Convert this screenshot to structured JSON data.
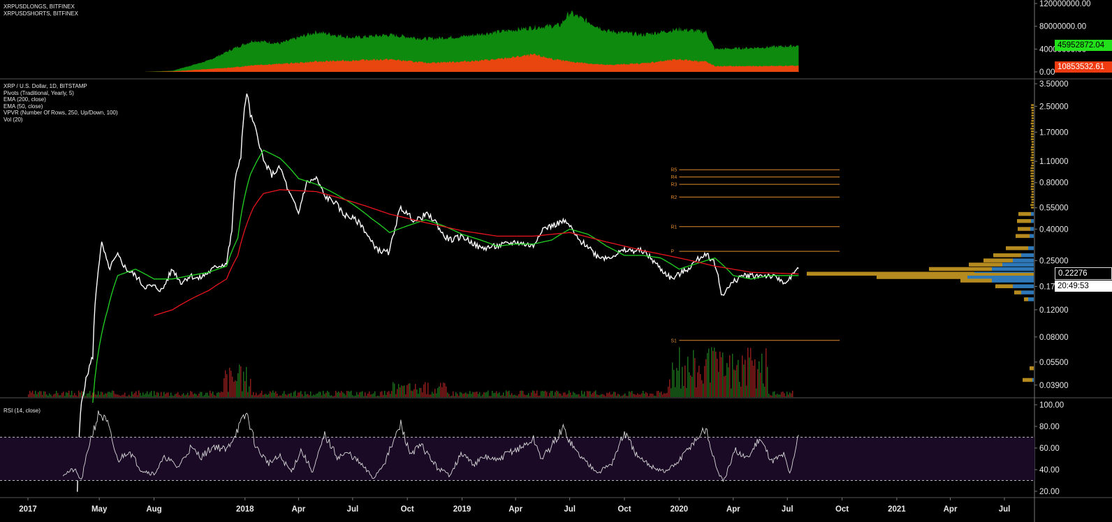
{
  "legends": {
    "top": [
      "XRPUSDLONGS, BITFINEX",
      "XRPUSDSHORTS, BITFINEX"
    ],
    "main": [
      "XRP / U.S. Dollar, 1D, BITSTAMP",
      "Pivots (Traditional, Yearly, 5)",
      "EMA (200, close)",
      "EMA (50, close)",
      "VPVR (Number Of Rows, 250, Up/Down, 100)",
      "Vol (20)"
    ],
    "rsi": [
      "RSI (14, close)"
    ]
  },
  "badges": {
    "longs": "45952872.04",
    "shorts": "10853532.61",
    "price": "0.22276",
    "countdown": "20:49:53"
  },
  "colors": {
    "longs": "#0e8a0e",
    "shorts": "#e8460e",
    "price": "#ffffff",
    "ema200": "#e8141e",
    "ema50": "#22d322",
    "pivot": "#e08a2e",
    "vol_up": "#1f7a1f",
    "vol_down": "#a02020",
    "vpvr_up": "#2f78b8",
    "vpvr_down": "#b58a1e",
    "rsi_line": "#d8d8d8",
    "rsi_band": "#1a0a26",
    "longs_badge": "#22e01a",
    "shorts_badge": "#f03a10"
  },
  "chart_data": [
    {
      "type": "area",
      "pane": "longs-shorts",
      "yticks": [
        "120000000.00",
        "80000000.00",
        "40000000.00",
        "0.00"
      ],
      "ylim": [
        0,
        120000000
      ],
      "series": [
        {
          "name": "XRPUSDLONGS, BITFINEX",
          "x": [
            "2017-07-15",
            "2017-09-01",
            "2017-11-01",
            "2017-12-15",
            "2018-01-15",
            "2018-03-01",
            "2018-05-01",
            "2018-07-01",
            "2018-09-01",
            "2018-11-01",
            "2019-01-01",
            "2019-03-01",
            "2019-05-01",
            "2019-06-15",
            "2019-07-01",
            "2019-09-01",
            "2019-11-01",
            "2020-01-01",
            "2020-02-15",
            "2020-03-01",
            "2020-05-01",
            "2020-07-20"
          ],
          "values": [
            0,
            2000000,
            20000000,
            42000000,
            55000000,
            50000000,
            70000000,
            60000000,
            65000000,
            58000000,
            62000000,
            70000000,
            78000000,
            82000000,
            104000000,
            72000000,
            65000000,
            75000000,
            70000000,
            40000000,
            42000000,
            46000000
          ]
        },
        {
          "name": "XRPUSDSHORTS, BITFINEX",
          "x": [
            "2017-07-15",
            "2017-09-01",
            "2017-11-01",
            "2017-12-15",
            "2018-01-15",
            "2018-03-01",
            "2018-05-01",
            "2018-07-01",
            "2018-09-01",
            "2018-11-01",
            "2019-01-01",
            "2019-03-01",
            "2019-05-01",
            "2019-06-15",
            "2019-07-01",
            "2019-09-01",
            "2019-11-01",
            "2020-01-01",
            "2020-02-15",
            "2020-03-01",
            "2020-05-01",
            "2020-07-20"
          ],
          "values": [
            0,
            1000000,
            5000000,
            8000000,
            12000000,
            14000000,
            18000000,
            20000000,
            22000000,
            16000000,
            18000000,
            22000000,
            30000000,
            20000000,
            18000000,
            12000000,
            15000000,
            22000000,
            18000000,
            10000000,
            10000000,
            10853532
          ]
        }
      ]
    },
    {
      "type": "line",
      "pane": "price",
      "scale": "log",
      "yticks": [
        "3.50000",
        "2.50000",
        "1.70000",
        "1.10000",
        "0.80000",
        "0.55000",
        "0.40000",
        "0.25000",
        "0.17000",
        "0.12000",
        "0.08000",
        "0.05500",
        "0.03900"
      ],
      "ylim": [
        0.034,
        3.5
      ],
      "xticks": [
        "2017",
        "May",
        "Aug",
        "2018",
        "Apr",
        "Jul",
        "Oct",
        "2019",
        "Apr",
        "Jul",
        "Oct",
        "2020",
        "Apr",
        "Jul",
        "Oct",
        "2021",
        "Apr",
        "Jul"
      ],
      "series": [
        {
          "name": "XRP / U.S. Dollar",
          "x": [
            "2017-03-25",
            "2017-04-01",
            "2017-04-20",
            "2017-05-05",
            "2017-05-17",
            "2017-06-01",
            "2017-06-15",
            "2017-07-01",
            "2017-07-15",
            "2017-08-01",
            "2017-08-15",
            "2017-09-01",
            "2017-09-15",
            "2017-10-01",
            "2017-10-15",
            "2017-11-01",
            "2017-11-15",
            "2017-12-01",
            "2017-12-10",
            "2017-12-15",
            "2017-12-25",
            "2018-01-04",
            "2018-01-10",
            "2018-01-20",
            "2018-02-01",
            "2018-02-15",
            "2018-03-01",
            "2018-03-15",
            "2018-04-01",
            "2018-04-15",
            "2018-05-01",
            "2018-05-15",
            "2018-06-01",
            "2018-06-15",
            "2018-07-01",
            "2018-07-15",
            "2018-08-01",
            "2018-08-15",
            "2018-09-01",
            "2018-09-20",
            "2018-10-01",
            "2018-10-15",
            "2018-11-01",
            "2018-11-15",
            "2018-12-01",
            "2018-12-15",
            "2019-01-01",
            "2019-02-01",
            "2019-03-01",
            "2019-04-01",
            "2019-05-01",
            "2019-05-15",
            "2019-06-01",
            "2019-06-20",
            "2019-07-01",
            "2019-07-15",
            "2019-08-01",
            "2019-08-15",
            "2019-09-01",
            "2019-10-01",
            "2019-11-01",
            "2019-12-01",
            "2019-12-20",
            "2020-01-15",
            "2020-02-15",
            "2020-03-01",
            "2020-03-12",
            "2020-03-20",
            "2020-04-01",
            "2020-04-15",
            "2020-05-01",
            "2020-05-15",
            "2020-06-01",
            "2020-06-15",
            "2020-07-01",
            "2020-07-20"
          ],
          "values": [
            0.008,
            0.03,
            0.06,
            0.32,
            0.22,
            0.27,
            0.22,
            0.2,
            0.17,
            0.17,
            0.16,
            0.22,
            0.18,
            0.2,
            0.19,
            0.21,
            0.23,
            0.24,
            0.38,
            0.8,
            1.2,
            3.1,
            2.2,
            1.7,
            1.1,
            0.9,
            1.0,
            0.7,
            0.5,
            0.8,
            0.85,
            0.65,
            0.6,
            0.5,
            0.47,
            0.43,
            0.33,
            0.29,
            0.28,
            0.55,
            0.5,
            0.45,
            0.5,
            0.46,
            0.36,
            0.34,
            0.36,
            0.3,
            0.31,
            0.33,
            0.31,
            0.4,
            0.42,
            0.45,
            0.42,
            0.34,
            0.31,
            0.27,
            0.26,
            0.29,
            0.29,
            0.22,
            0.19,
            0.22,
            0.28,
            0.24,
            0.15,
            0.16,
            0.18,
            0.2,
            0.2,
            0.2,
            0.2,
            0.19,
            0.18,
            0.22276
          ]
        },
        {
          "name": "EMA (50, close)",
          "x": [
            "2017-04-20",
            "2017-05-15",
            "2017-06-01",
            "2017-07-01",
            "2017-08-01",
            "2017-09-01",
            "2017-10-01",
            "2017-11-01",
            "2017-12-01",
            "2017-12-20",
            "2018-01-10",
            "2018-02-01",
            "2018-03-01",
            "2018-04-01",
            "2018-05-01",
            "2018-06-01",
            "2018-07-01",
            "2018-08-01",
            "2018-09-01",
            "2018-10-01",
            "2018-11-01",
            "2018-12-01",
            "2019-01-01",
            "2019-02-01",
            "2019-03-01",
            "2019-04-01",
            "2019-05-01",
            "2019-06-01",
            "2019-07-01",
            "2019-08-01",
            "2019-09-01",
            "2019-10-01",
            "2019-11-01",
            "2019-12-01",
            "2020-01-01",
            "2020-02-01",
            "2020-03-01",
            "2020-04-01",
            "2020-05-01",
            "2020-06-01",
            "2020-07-20"
          ],
          "values": [
            0.03,
            0.12,
            0.2,
            0.22,
            0.19,
            0.19,
            0.2,
            0.21,
            0.23,
            0.35,
            0.9,
            1.3,
            1.15,
            0.85,
            0.78,
            0.68,
            0.58,
            0.47,
            0.38,
            0.42,
            0.46,
            0.42,
            0.37,
            0.34,
            0.31,
            0.32,
            0.32,
            0.34,
            0.4,
            0.37,
            0.31,
            0.27,
            0.27,
            0.26,
            0.22,
            0.24,
            0.26,
            0.2,
            0.19,
            0.2,
            0.2
          ]
        },
        {
          "name": "EMA (200, close)",
          "x": [
            "2017-08-01",
            "2017-09-01",
            "2017-10-01",
            "2017-11-01",
            "2017-12-01",
            "2017-12-20",
            "2018-01-15",
            "2018-02-01",
            "2018-03-01",
            "2018-05-01",
            "2018-07-01",
            "2018-09-01",
            "2018-11-01",
            "2019-01-01",
            "2019-03-01",
            "2019-05-01",
            "2019-07-01",
            "2019-09-01",
            "2019-11-01",
            "2020-01-01",
            "2020-03-01",
            "2020-05-01",
            "2020-07-20"
          ],
          "values": [
            0.11,
            0.12,
            0.14,
            0.16,
            0.19,
            0.27,
            0.55,
            0.68,
            0.72,
            0.7,
            0.6,
            0.5,
            0.44,
            0.39,
            0.36,
            0.36,
            0.38,
            0.33,
            0.29,
            0.26,
            0.23,
            0.21,
            0.205
          ]
        }
      ]
    },
    {
      "type": "line",
      "pane": "pivots",
      "levels": [
        {
          "label": "R5",
          "value": 0.97
        },
        {
          "label": "R4",
          "value": 0.87
        },
        {
          "label": "R3",
          "value": 0.78
        },
        {
          "label": "R2",
          "value": 0.645
        },
        {
          "label": "R1",
          "value": 0.415
        },
        {
          "label": "P",
          "value": 0.287
        },
        {
          "label": "S1",
          "value": 0.076
        }
      ],
      "x_start": "2019-12-18",
      "x_end": "2020-09-27"
    },
    {
      "type": "bar",
      "pane": "volume-profile",
      "bins": [
        {
          "price": 0.3,
          "up": 8,
          "down": 32
        },
        {
          "price": 0.27,
          "up": 18,
          "down": 40
        },
        {
          "price": 0.25,
          "up": 30,
          "down": 42
        },
        {
          "price": 0.235,
          "up": 45,
          "down": 48
        },
        {
          "price": 0.22,
          "up": 60,
          "down": 90
        },
        {
          "price": 0.205,
          "up": 85,
          "down": 240
        },
        {
          "price": 0.195,
          "up": 95,
          "down": 130
        },
        {
          "price": 0.185,
          "up": 60,
          "down": 45
        },
        {
          "price": 0.17,
          "up": 30,
          "down": 25
        },
        {
          "price": 0.155,
          "up": 18,
          "down": 10
        },
        {
          "price": 0.14,
          "up": 8,
          "down": 6
        },
        {
          "price": 0.5,
          "up": 4,
          "down": 18
        },
        {
          "price": 0.45,
          "up": 4,
          "down": 20
        },
        {
          "price": 0.4,
          "up": 5,
          "down": 18
        },
        {
          "price": 0.36,
          "up": 6,
          "down": 20
        },
        {
          "price": 0.05,
          "up": 0,
          "down": 6
        },
        {
          "price": 0.042,
          "up": 2,
          "down": 14
        }
      ]
    },
    {
      "type": "line",
      "pane": "rsi",
      "yticks": [
        "100.00",
        "80.00",
        "60.00",
        "40.00",
        "20.00"
      ],
      "ylim": [
        20,
        100
      ],
      "band": [
        30,
        70
      ],
      "series": [
        {
          "name": "RSI (14, close)",
          "x": [
            "2017-03-01",
            "2017-03-20",
            "2017-04-01",
            "2017-04-15",
            "2017-05-01",
            "2017-05-15",
            "2017-06-01",
            "2017-06-20",
            "2017-07-10",
            "2017-08-01",
            "2017-08-20",
            "2017-09-10",
            "2017-10-01",
            "2017-10-20",
            "2017-11-10",
            "2017-12-01",
            "2017-12-20",
            "2018-01-04",
            "2018-01-20",
            "2018-02-10",
            "2018-03-01",
            "2018-03-20",
            "2018-04-05",
            "2018-04-25",
            "2018-05-15",
            "2018-06-05",
            "2018-06-25",
            "2018-07-15",
            "2018-08-05",
            "2018-08-25",
            "2018-09-20",
            "2018-10-05",
            "2018-10-25",
            "2018-11-20",
            "2018-12-10",
            "2019-01-01",
            "2019-01-20",
            "2019-02-10",
            "2019-03-01",
            "2019-03-20",
            "2019-04-10",
            "2019-05-01",
            "2019-05-15",
            "2019-06-01",
            "2019-06-20",
            "2019-07-10",
            "2019-08-01",
            "2019-08-20",
            "2019-09-10",
            "2019-10-01",
            "2019-10-25",
            "2019-11-20",
            "2019-12-10",
            "2020-01-01",
            "2020-01-20",
            "2020-02-15",
            "2020-03-01",
            "2020-03-15",
            "2020-04-05",
            "2020-04-25",
            "2020-05-15",
            "2020-06-05",
            "2020-06-25",
            "2020-07-05",
            "2020-07-20"
          ],
          "values": [
            36,
            40,
            30,
            66,
            93,
            82,
            48,
            58,
            40,
            36,
            52,
            42,
            60,
            52,
            62,
            58,
            78,
            92,
            60,
            46,
            52,
            38,
            58,
            38,
            72,
            52,
            55,
            45,
            32,
            48,
            82,
            55,
            62,
            42,
            35,
            55,
            45,
            52,
            48,
            56,
            60,
            68,
            50,
            62,
            78,
            58,
            45,
            38,
            46,
            74,
            50,
            42,
            38,
            48,
            62,
            78,
            46,
            28,
            58,
            50,
            70,
            48,
            54,
            36,
            72
          ]
        }
      ]
    }
  ]
}
